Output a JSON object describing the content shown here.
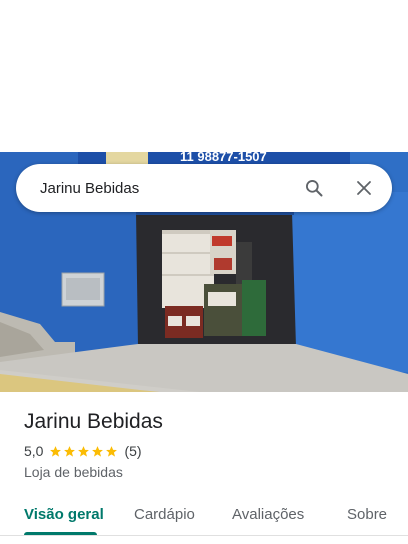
{
  "search": {
    "query": "Jarinu Bebidas"
  },
  "photo": {
    "sign_text": "11 98877-1507"
  },
  "place": {
    "name": "Jarinu Bebidas",
    "rating": "5,0",
    "stars_filled": 5,
    "review_count": "(5)",
    "category": "Loja de bebidas"
  },
  "tabs": [
    {
      "label": "Visão geral",
      "active": true
    },
    {
      "label": "Cardápio",
      "active": false
    },
    {
      "label": "Avaliações",
      "active": false
    },
    {
      "label": "Sobre",
      "active": false
    }
  ],
  "colors": {
    "accent": "#00796b",
    "star": "#fbbc04",
    "wall": "#2f6fc6"
  }
}
